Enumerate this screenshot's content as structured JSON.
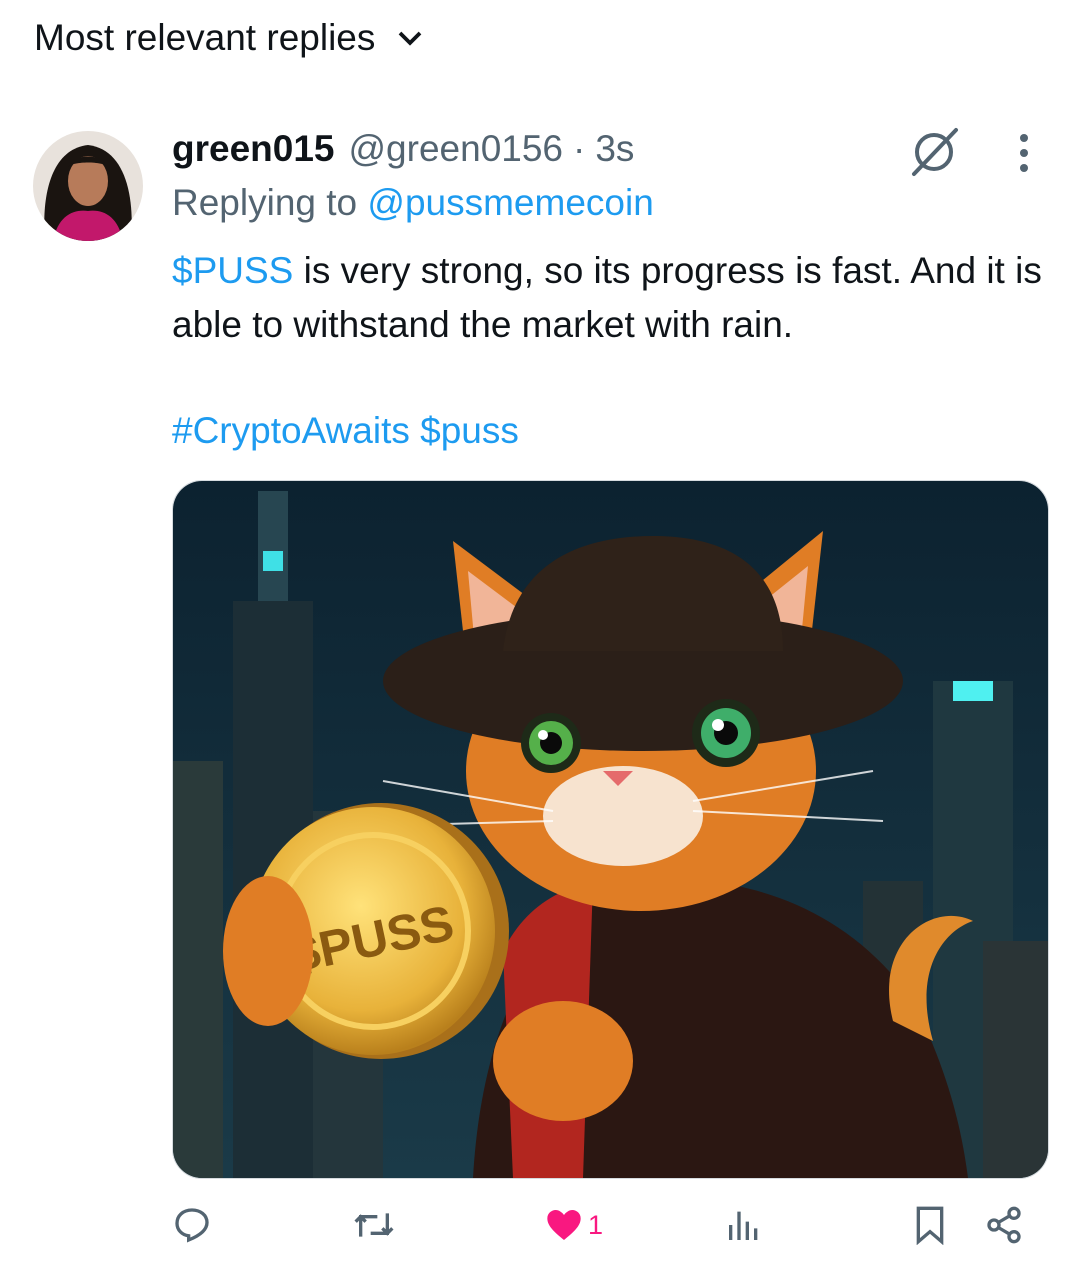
{
  "sort": {
    "label": "Most relevant replies"
  },
  "tweet": {
    "author_name": "green015",
    "author_handle": "@green0156",
    "separator": "·",
    "timestamp": "3s",
    "replying_label": "Replying to",
    "replying_to": "@pussmemecoin",
    "text_link": "$PUSS",
    "text_rest": " is very strong, so its progress is fast. And it is able to withstand the market with rain.",
    "hashtag": "#CryptoAwaits",
    "cashtag": "$puss",
    "image_coin_text": "$PUSS"
  },
  "actions": {
    "reply_icon": "reply-icon",
    "retweet_icon": "retweet-icon",
    "like_icon": "heart-filled-icon",
    "like_count": "1",
    "views_icon": "views-icon",
    "bookmark_icon": "bookmark-icon",
    "share_icon": "share-icon"
  },
  "colors": {
    "accent": "#1d9bf0",
    "like": "#f91880",
    "muted": "#536471"
  }
}
